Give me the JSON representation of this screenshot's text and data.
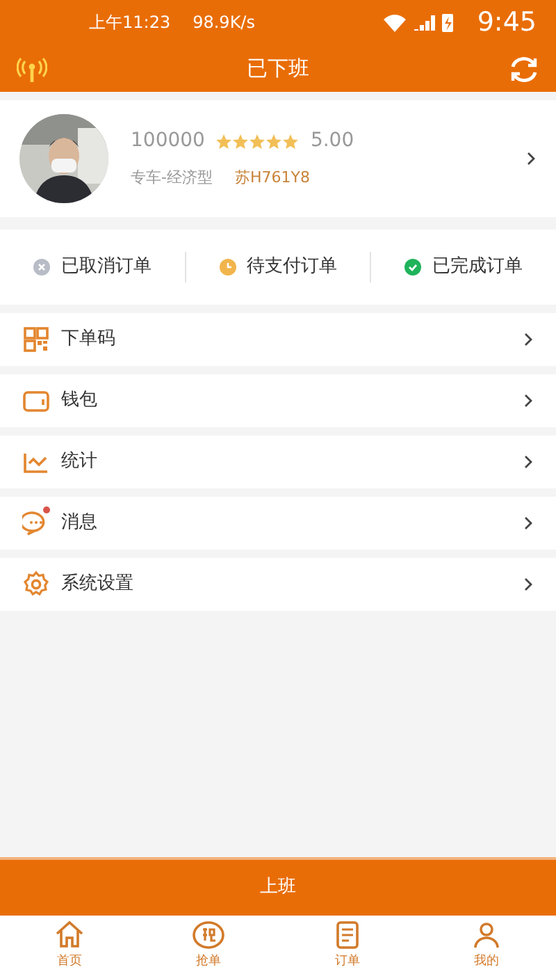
{
  "status_bar": {
    "left_time": "上午11:23",
    "speed": "98.9K/s",
    "clock": "9:45"
  },
  "header": {
    "title": "已下班"
  },
  "profile": {
    "id": "100000",
    "stars": 5,
    "rating": "5.00",
    "car_type": "专车-经济型",
    "plate": "苏H761Y8"
  },
  "order_statuses": [
    {
      "label": "已取消订单",
      "kind": "cancelled",
      "color": "#b8bcc6"
    },
    {
      "label": "待支付订单",
      "kind": "pending",
      "color": "#f2b54c"
    },
    {
      "label": "已完成订单",
      "kind": "done",
      "color": "#1fb35a"
    }
  ],
  "menu": [
    {
      "label": "下单码",
      "kind": "qr",
      "badge": false
    },
    {
      "label": "钱包",
      "kind": "wallet",
      "badge": false
    },
    {
      "label": "统计",
      "kind": "chart",
      "badge": false
    },
    {
      "label": "消息",
      "kind": "message",
      "badge": true
    },
    {
      "label": "系统设置",
      "kind": "settings",
      "badge": false
    }
  ],
  "action_button": "上班",
  "tabbar": [
    {
      "label": "首页",
      "kind": "home"
    },
    {
      "label": "抢单",
      "kind": "grab"
    },
    {
      "label": "订单",
      "kind": "orders"
    },
    {
      "label": "我的",
      "kind": "me"
    }
  ]
}
